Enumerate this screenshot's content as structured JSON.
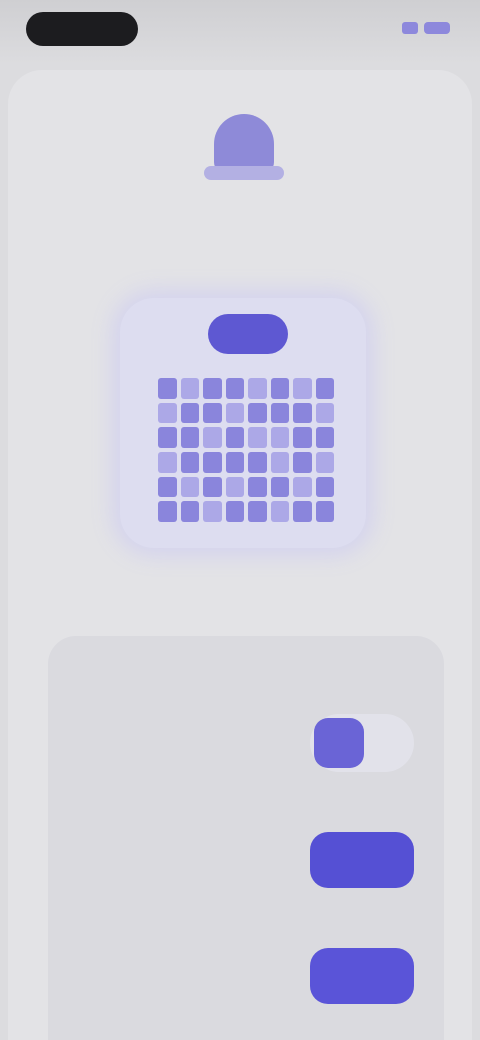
{
  "status_bar": {
    "time": "",
    "icons": [
      "signal-icon",
      "battery-icon"
    ]
  },
  "header": {
    "icon": "user-icon",
    "title": "",
    "subtitle": ""
  },
  "qr_card": {
    "pill_label": "",
    "pattern": [
      [
        1,
        0,
        1,
        1,
        0,
        1,
        0,
        1
      ],
      [
        0,
        1,
        1,
        0,
        1,
        1,
        1,
        0
      ],
      [
        1,
        1,
        0,
        1,
        0,
        0,
        1,
        1
      ],
      [
        0,
        1,
        1,
        1,
        1,
        0,
        1,
        0
      ],
      [
        1,
        0,
        1,
        0,
        1,
        1,
        0,
        1
      ],
      [
        1,
        1,
        0,
        1,
        1,
        0,
        1,
        1
      ]
    ]
  },
  "settings": {
    "title": "",
    "rows": [
      {
        "label": "",
        "description": "",
        "control": "toggle",
        "on": false
      },
      {
        "label": "",
        "description": "",
        "control": "stepper",
        "minus": "",
        "plus": ""
      },
      {
        "label": "",
        "description": "",
        "control": "button",
        "button_label": ""
      }
    ]
  },
  "colors": {
    "accent": "#5a54d8",
    "accent_light": "#8e8ad8",
    "background": "#dcdcdf",
    "card": "#dadadf"
  }
}
